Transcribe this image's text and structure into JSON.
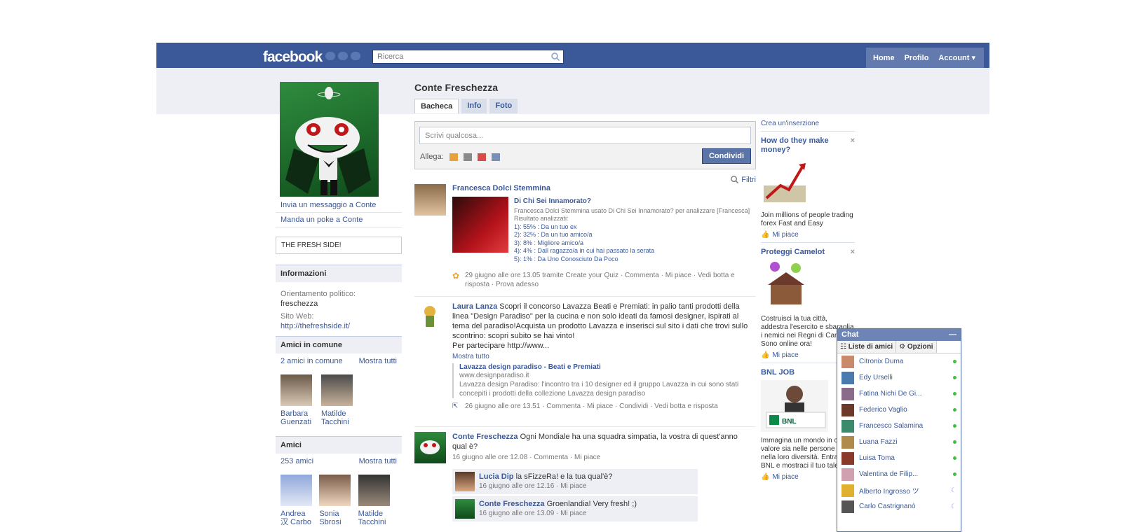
{
  "topbar": {
    "logo": "facebook",
    "search_placeholder": "Ricerca",
    "nav": [
      "Home",
      "Profilo",
      "Account ▾"
    ]
  },
  "profile": {
    "name": "Conte Freschezza",
    "tabs": [
      "Bacheca",
      "Info",
      "Foto"
    ],
    "actions": [
      "Invia un messaggio a Conte",
      "Manda un poke a Conte"
    ],
    "tagline": "THE FRESH SIDE!"
  },
  "info": {
    "header": "Informazioni",
    "political_label": "Orientamento politico:",
    "political_value": "freschezza",
    "website_label": "Sito Web:",
    "website_value": "http://thefreshside.it/"
  },
  "mutual": {
    "header": "Amici in comune",
    "count": "2 amici in comune",
    "show_all": "Mostra tutti",
    "friends": [
      {
        "name": "Barbara Guenzati"
      },
      {
        "name": "Matilde Tacchini"
      }
    ]
  },
  "friends": {
    "header": "Amici",
    "count": "253 amici",
    "show_all": "Mostra tutti",
    "list": [
      {
        "name": "Andrea 汉 Carbo"
      },
      {
        "name": "Sonia Sbrosi"
      },
      {
        "name": "Matilde Tacchini"
      }
    ]
  },
  "composer": {
    "placeholder": "Scrivi qualcosa...",
    "attach_label": "Allega:",
    "share_button": "Condividi"
  },
  "filters_label": "Filtri",
  "stories": [
    {
      "author": "Francesca Dolci Stemmina",
      "quiz_title": "Di Chi Sei Innamorato?",
      "quiz_desc": "Francesca Dolci Stemmina usato Di Chi Sei Innamorato? per analizzare [Francesca]",
      "results_label": "Risultato analizzati:",
      "results": [
        "1):  55% : Da un tuo ex",
        "2):  32% : Da un tuo amico/a",
        "3):  8% : Migliore amico/a",
        "4):  4% : Dall ragazzo/a in cui hai passato la serata",
        "5):  1% : Da Uno Conosciuto Da Poco"
      ],
      "meta": "29 giugno alle ore 13.05 tramite Create your Quiz · Commenta · Mi piace · Vedi botta e risposta · Prova adesso"
    },
    {
      "author": "Laura Lanza",
      "message": "Scopri il concorso Lavazza Beati e Premiati: in palio tanti prodotti della linea \"Design Paradiso\" per la cucina e non solo ideati da famosi designer, ispirati al tema del paradiso!Acquista un prodotto Lavazza e inserisci sul sito i dati che trovi sullo scontrino: scopri subito se hai vinto!",
      "message2": "Per partecipare http://www...",
      "show_more": "Mostra tutto",
      "link_title": "Lavazza design paradiso - Beati e Premiati",
      "link_url": "www.designparadiso.it",
      "link_desc": "Lavazza design Paradiso: l'incontro tra i 10 designer ed il gruppo Lavazza in cui sono stati concepiti i prodotti della collezione Lavazza design paradiso",
      "meta": "26 giugno alle ore 13.51 · Commenta · Mi piace · Condividi · Vedi botta e risposta"
    },
    {
      "author": "Conte Freschezza",
      "message": "Ogni Mondiale ha una squadra simpatia, la vostra di quest'anno qual è?",
      "meta": "16 giugno alle ore 12.08 · Commenta · Mi piace",
      "comments": [
        {
          "author": "Lucia Dip",
          "text": "la sFizzeRa! e la tua qual'è?",
          "meta": "16 giugno alle ore 12.16 · Mi piace"
        },
        {
          "author": "Conte Freschezza",
          "text": "Groenlandia! Very fresh! ;)",
          "meta": "16 giugno alle ore 13.09 · Mi piace"
        }
      ]
    }
  ],
  "ads": {
    "create": "Crea un'inserzione",
    "items": [
      {
        "title": "How do they make money?",
        "body": "Join millions of people trading forex Fast and Easy",
        "like": "Mi piace"
      },
      {
        "title": "Proteggi Camelot",
        "body": "Costruisci la tua città, addestra l'esercito e sbaraglia i nemici nei Regni di Camelot. Sono online ora!",
        "like": "Mi piace"
      },
      {
        "title": "BNL JOB",
        "body": "Immagina un mondo in cui il valore sia nelle persone e nella loro diversità. Entra in BNL e mostraci il tuo talento",
        "like": "Mi piace"
      }
    ]
  },
  "chat": {
    "title": "Chat",
    "minimize": "—",
    "tab_lists": "Liste di amici",
    "tab_options": "Opzioni",
    "contacts": [
      {
        "name": "Citronix Duma",
        "status": "online"
      },
      {
        "name": "Edy Urselli",
        "status": "online"
      },
      {
        "name": "Fatina Nichi De Gi...",
        "status": "online"
      },
      {
        "name": "Federico Vaglio",
        "status": "online"
      },
      {
        "name": "Francesco Salamina",
        "status": "online"
      },
      {
        "name": "Luana Fazzi",
        "status": "online"
      },
      {
        "name": "Luisa Toma",
        "status": "online"
      },
      {
        "name": "Valentina de Filip...",
        "status": "online"
      },
      {
        "name": "Alberto Ingrosso ツ",
        "status": "idle"
      },
      {
        "name": "Carlo Castrignanò",
        "status": "idle"
      }
    ]
  },
  "colors": {
    "brand": "#3b5998",
    "topbar": "#3b5998",
    "online": "#3ebf3e"
  }
}
